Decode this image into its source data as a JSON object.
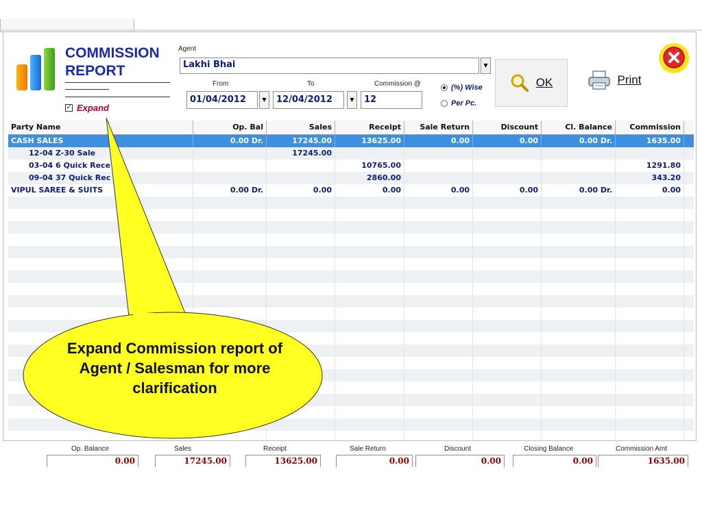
{
  "header": {
    "title_line1": "COMMISSION",
    "title_line2": "REPORT",
    "expand_label": "Expand",
    "expand_checked": true
  },
  "filters": {
    "agent_label": "Agent",
    "agent_value": "Lakhi Bhai",
    "from_label": "From",
    "from_value": "01/04/2012",
    "to_label": "To",
    "to_value": "12/04/2012",
    "commission_label": "Commission @",
    "commission_value": "12",
    "mode_options": [
      "(%) Wise",
      "Per Pc."
    ],
    "mode_selected": "(%) Wise"
  },
  "buttons": {
    "ok_label": "OK",
    "print_label": "Print"
  },
  "table": {
    "columns": [
      "Party Name",
      "Op. Bal",
      "Sales",
      "Receipt",
      "Sale Return",
      "Discount",
      "Cl. Balance",
      "Commission"
    ],
    "rows": [
      [
        "CASH SALES",
        "0.00 Dr.",
        "17245.00",
        "13625.00",
        "0.00",
        "0.00",
        "0.00 Dr.",
        "1635.00"
      ],
      [
        "12-04 Z-30 Sale",
        "",
        "17245.00",
        "",
        "",
        "",
        "",
        ""
      ],
      [
        "03-04 6 Quick Rece",
        "",
        "",
        "10765.00",
        "",
        "",
        "",
        "1291.80"
      ],
      [
        "09-04 37 Quick Rec",
        "",
        "",
        "2860.00",
        "",
        "",
        "",
        "343.20"
      ],
      [
        "VIPUL SAREE & SUITS",
        "0.00 Dr.",
        "0.00",
        "0.00",
        "0.00",
        "0.00",
        "0.00 Dr.",
        "0.00"
      ]
    ],
    "selected_row": 0
  },
  "footer": {
    "labels": [
      "Op. Balance",
      "Sales",
      "Receipt",
      "Sale Return",
      "Discount",
      "Closing Balance",
      "Commission Amt"
    ],
    "values": [
      "0.00",
      "17245.00",
      "13625.00",
      "0.00",
      "0.00",
      "0.00",
      "1635.00"
    ]
  },
  "callout": {
    "text": "Expand Commission report of Agent / Salesman for more clarification"
  },
  "colors": {
    "title": "#1d2aa8",
    "selected_row": "#3d8fe0",
    "grid_text": "#0b1d7a",
    "expand_label": "#b3001e",
    "footer_value": "#8b0000",
    "callout_fill": "#ffff22",
    "close_icon": "#e0282a"
  },
  "icons": [
    "bar-chart-logo",
    "magnifier-icon",
    "printer-icon",
    "close-icon",
    "dropdown-arrow-icon",
    "checkbox-icon",
    "radio-icon"
  ]
}
